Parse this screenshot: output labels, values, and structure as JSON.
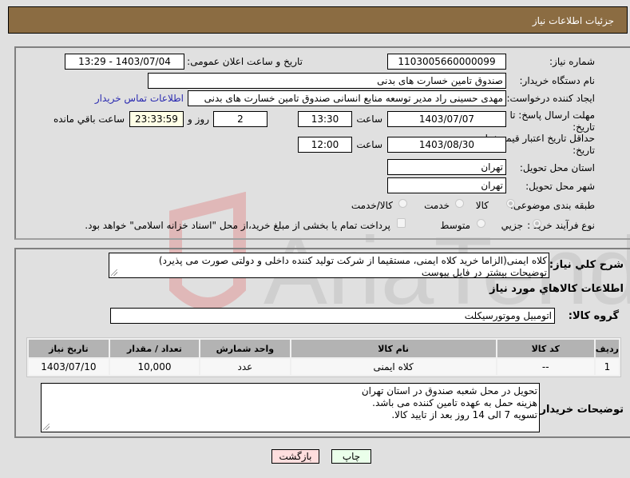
{
  "header": {
    "title": "جزئیات اطلاعات نیاز"
  },
  "form": {
    "need_number": {
      "label": "شماره نیاز:",
      "value": "1103005660000099"
    },
    "announce_datetime": {
      "label": "تاریخ و ساعت اعلان عمومی:",
      "value": "1403/07/04 - 13:29"
    },
    "buyer_org": {
      "label": "نام دستگاه خریدار:",
      "value": "صندوق تامین خسارت های بدنی"
    },
    "requester": {
      "label": "ایجاد کننده درخواست:",
      "value": "مهدی حسینی راد مدیر توسعه منابع انسانی صندوق تامین خسارت های بدنی",
      "contact_link": "اطلاعات تماس خریدار"
    },
    "reply_deadline": {
      "label_line1": "مهلت ارسال پاسخ: تا",
      "label_line2": "تاریخ:",
      "date": "1403/07/07",
      "time_label": "ساعت",
      "time": "13:30",
      "days": "2",
      "days_label": "روز و",
      "remaining": "23:33:59",
      "remaining_label": "ساعت باقي مانده"
    },
    "price_validity": {
      "label_line1": "حداقل تاریخ اعتبار قیمت: تا",
      "label_line2": "تاریخ:",
      "date": "1403/08/30",
      "time_label": "ساعت",
      "time": "12:00"
    },
    "delivery_province": {
      "label": "استان محل تحویل:",
      "value": "تهران"
    },
    "delivery_city": {
      "label": "شهر محل تحویل:",
      "value": "تهران"
    },
    "category": {
      "label": "طبقه بندی موضوعی:",
      "options": [
        {
          "label": "کالا",
          "selected": true
        },
        {
          "label": "خدمت",
          "selected": false
        },
        {
          "label": "کالا/خدمت",
          "selected": false
        }
      ]
    },
    "purchase_type": {
      "label": "نوع فرآیند خرید :",
      "options": [
        {
          "label": "جزیي",
          "selected": true
        },
        {
          "label": "متوسط",
          "selected": false
        }
      ],
      "treasury_checkbox": {
        "label": "پرداخت تمام یا بخشی از مبلغ خرید،از محل \"اسناد خزانه اسلامی\" خواهد بود.",
        "checked": false
      }
    }
  },
  "details": {
    "description": {
      "label": "شرح کلي نياز:",
      "line1": "کلاه ایمنی(الزاما خرید کلاه ایمنی، مستقیما از شرکت تولید کننده داخلی و دولتی صورت می پذیرد)",
      "line2": "توضیحات بیشتر در فایل پیوست"
    },
    "items_title": "اطلاعات کالاهاي مورد نياز",
    "goods_group": {
      "label": "گروه کالا:",
      "value": "اتومبیل وموتورسیکلت"
    },
    "table": {
      "headers": [
        "ردیف",
        "کد کالا",
        "نام کالا",
        "واحد شمارش",
        "تعداد / مقدار",
        "تاریخ نیاز"
      ],
      "rows": [
        [
          "1",
          "--",
          "کلاه ایمنی",
          "عدد",
          "10,000",
          "1403/07/10"
        ]
      ]
    },
    "buyer_notes": {
      "label": "توضیحات خریدار:",
      "line1": "تحویل در محل شعبه صندوق در استان تهران",
      "line2": "هزینه حمل به عهده تامین کننده می باشد.",
      "line3": "تسویه 7 الی 14 روز بعد از تایید کالا."
    }
  },
  "buttons": {
    "print": "چاپ",
    "back": "بازگشت"
  },
  "colors": {
    "header_bg": "#8b6c42",
    "print_bg": "#eaffea",
    "back_bg": "#ffdede",
    "link": "#2a2ab0"
  }
}
